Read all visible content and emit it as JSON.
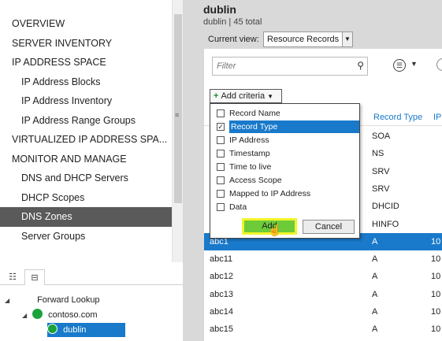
{
  "nav": {
    "items": [
      {
        "label": "OVERVIEW",
        "level": 0
      },
      {
        "label": "SERVER INVENTORY",
        "level": 0
      },
      {
        "label": "IP ADDRESS SPACE",
        "level": 0
      },
      {
        "label": "IP Address Blocks",
        "level": 1
      },
      {
        "label": "IP Address Inventory",
        "level": 1
      },
      {
        "label": "IP Address Range Groups",
        "level": 1
      },
      {
        "label": "VIRTUALIZED IP ADDRESS SPA...",
        "level": 0
      },
      {
        "label": "MONITOR AND MANAGE",
        "level": 0
      },
      {
        "label": "DNS and DHCP Servers",
        "level": 1
      },
      {
        "label": "DHCP Scopes",
        "level": 1
      },
      {
        "label": "DNS Zones",
        "level": 1,
        "selected": true
      },
      {
        "label": "Server Groups",
        "level": 1
      }
    ],
    "scroll_grip": "≡"
  },
  "tree_tabs": {
    "list_icon": "☷",
    "tree_icon": "⊟"
  },
  "tree": {
    "forward_lookup": "Forward Lookup",
    "contoso": "contoso.com",
    "dublin": "dublin",
    "expand_arrow": "◢"
  },
  "header": {
    "title": "dublin",
    "subtitle": "dublin | 45 total",
    "current_view_label": "Current view:",
    "current_view_value": "Resource Records",
    "select_arrow": "▼"
  },
  "filter": {
    "placeholder": "Filter",
    "search_icon": "⚲",
    "options_icon": "☰",
    "options_arrow": "▼"
  },
  "add_criteria": {
    "plus": "+",
    "label": "Add criteria",
    "caret": "▼"
  },
  "columns": {
    "record_type": "Record Type",
    "ip": "IP"
  },
  "records": [
    {
      "name": "",
      "type": "SOA",
      "ip": ""
    },
    {
      "name": "",
      "type": "NS",
      "ip": ""
    },
    {
      "name": "",
      "type": "SRV",
      "ip": ""
    },
    {
      "name": "",
      "type": "SRV",
      "ip": ""
    },
    {
      "name": "",
      "type": "DHCID",
      "ip": ""
    },
    {
      "name": "",
      "type": "HINFO",
      "ip": ""
    },
    {
      "name": "abc1",
      "type": "A",
      "ip": "10",
      "selected": true
    },
    {
      "name": "abc11",
      "type": "A",
      "ip": "10"
    },
    {
      "name": "abc12",
      "type": "A",
      "ip": "10"
    },
    {
      "name": "abc13",
      "type": "A",
      "ip": "10"
    },
    {
      "name": "abc14",
      "type": "A",
      "ip": "10"
    },
    {
      "name": "abc15",
      "type": "A",
      "ip": "10"
    }
  ],
  "criteria": {
    "items": [
      {
        "label": "Record Name",
        "checked": false
      },
      {
        "label": "Record Type",
        "checked": true
      },
      {
        "label": "IP Address",
        "checked": false
      },
      {
        "label": "Timestamp",
        "checked": false
      },
      {
        "label": "Time to live",
        "checked": false
      },
      {
        "label": "Access Scope",
        "checked": false
      },
      {
        "label": "Mapped to IP Address",
        "checked": false
      },
      {
        "label": "Data",
        "checked": false
      }
    ],
    "check_glyph": "✓",
    "add_label": "Add",
    "cancel_label": "Cancel",
    "cursor": "☝"
  }
}
